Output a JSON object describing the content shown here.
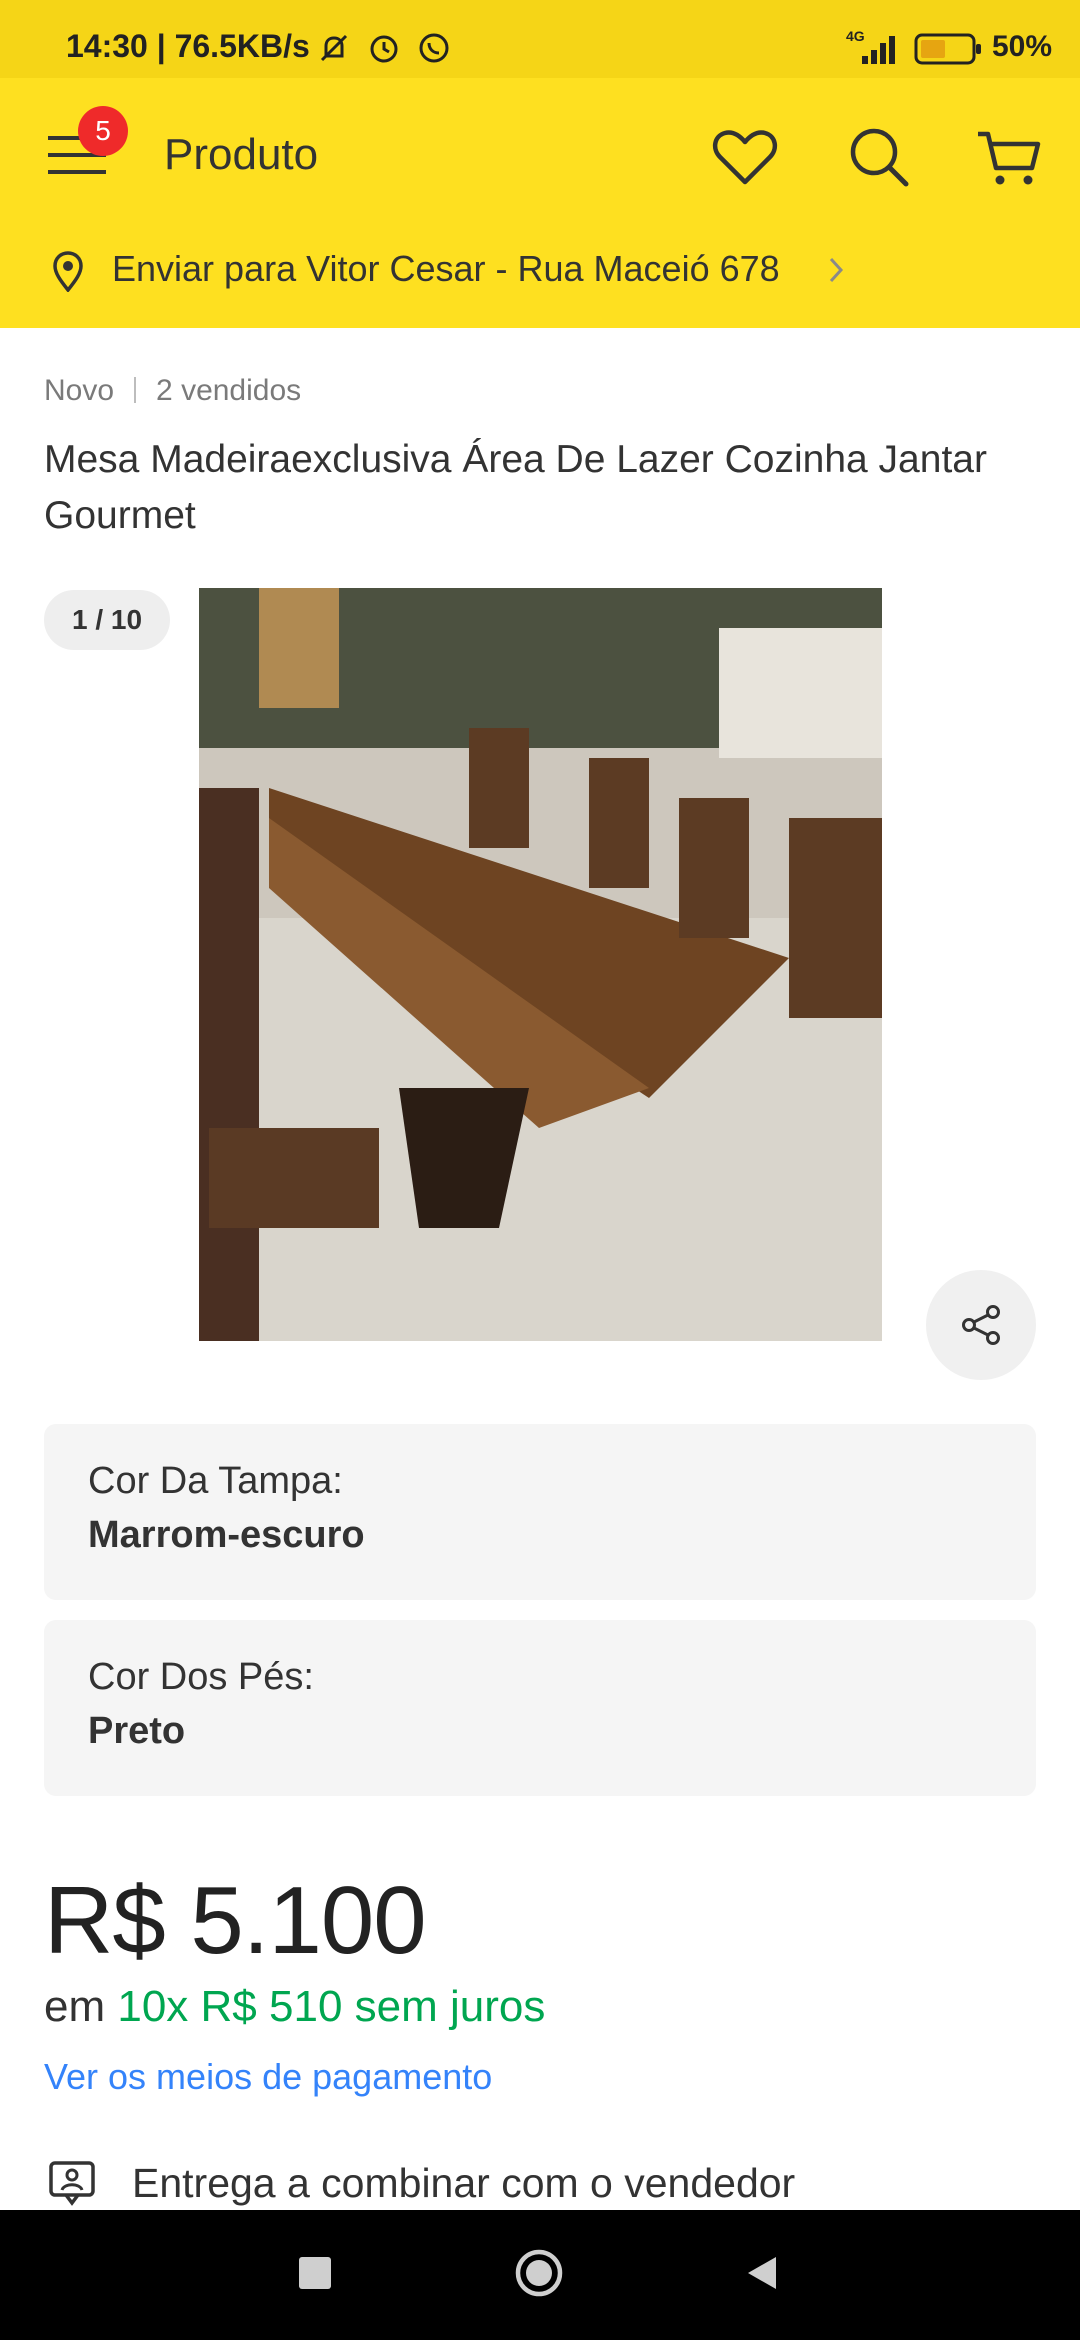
{
  "status_bar": {
    "time_speed": "14:30 | 76.5KB/s",
    "network": "4G",
    "battery": "50%",
    "icons": [
      "notifications-off-icon",
      "alarm-icon",
      "whatsapp-icon",
      "signal-icon",
      "battery-icon"
    ]
  },
  "header": {
    "title": "Produto",
    "menu_badge": "5",
    "icons": [
      "menu-icon",
      "heart-icon",
      "search-icon",
      "cart-icon"
    ]
  },
  "shipping_address": {
    "label": "Enviar para Vitor Cesar - Rua Maceió 678",
    "icon": "location-pin-icon"
  },
  "product": {
    "condition": "Novo",
    "sold": "2 vendidos",
    "title": "Mesa Madeiraexclusiva Área De Lazer Cozinha Jantar Gourmet",
    "image_counter": "1 / 10",
    "variations": [
      {
        "label": "Cor Da Tampa:",
        "value": "Marrom-escuro"
      },
      {
        "label": "Cor Dos Pés:",
        "value": "Preto"
      }
    ],
    "price": "R$ 5.100",
    "installments_prefix": "em",
    "installments_value": "10x R$ 510 sem juros",
    "payment_link": "Ver os meios de pagamento",
    "delivery": "Entrega a combinar com o vendedor"
  },
  "colors": {
    "brand_yellow": "#fee020",
    "green": "#00a650",
    "link_blue": "#3483fa",
    "badge_red": "#ef2a2a"
  }
}
